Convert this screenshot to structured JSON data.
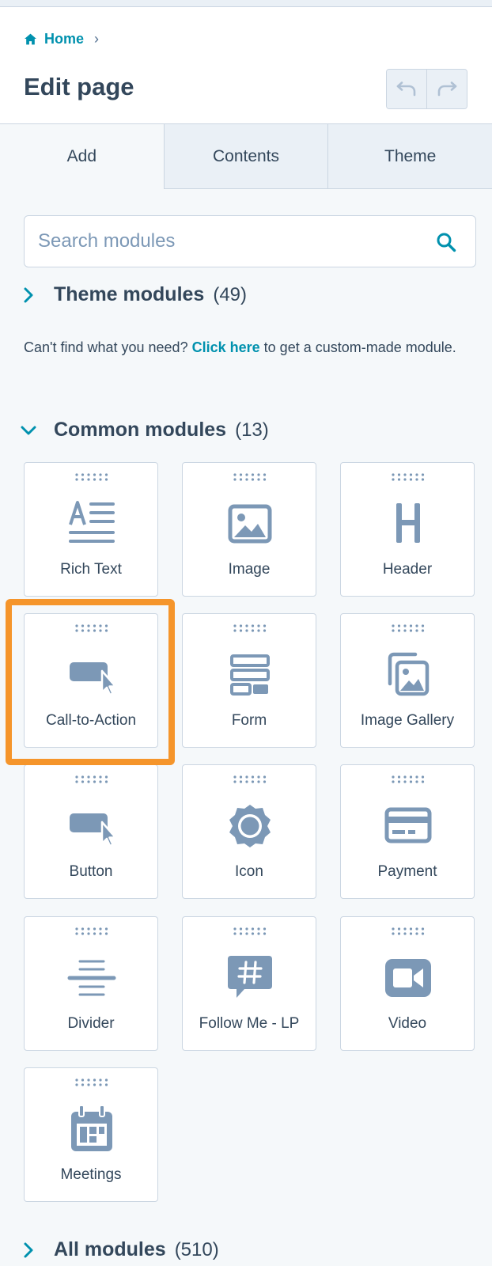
{
  "breadcrumb": {
    "home_label": "Home",
    "separator": "›"
  },
  "header": {
    "title": "Edit page"
  },
  "tabs": [
    {
      "label": "Add",
      "active": true
    },
    {
      "label": "Contents",
      "active": false
    },
    {
      "label": "Theme",
      "active": false
    }
  ],
  "search": {
    "placeholder": "Search modules",
    "value": ""
  },
  "sections": {
    "theme_modules": {
      "title": "Theme modules",
      "count": "(49)",
      "expanded": false
    },
    "common_modules": {
      "title": "Common modules",
      "count": "(13)",
      "expanded": true
    },
    "all_modules": {
      "title": "All modules",
      "count": "(510)",
      "expanded": false
    }
  },
  "help": {
    "text_before": "Can't find what you need?",
    "link_text": "Click here",
    "text_after": "to get a custom-made module."
  },
  "modules": [
    {
      "label": "Rich Text",
      "icon": "rich-text-icon"
    },
    {
      "label": "Image",
      "icon": "image-icon"
    },
    {
      "label": "Header",
      "icon": "header-icon"
    },
    {
      "label": "Call-to-Action",
      "icon": "call-to-action-icon",
      "highlighted": true
    },
    {
      "label": "Form",
      "icon": "form-icon"
    },
    {
      "label": "Image Gallery",
      "icon": "image-gallery-icon"
    },
    {
      "label": "Button",
      "icon": "button-icon"
    },
    {
      "label": "Icon",
      "icon": "icon-module-icon"
    },
    {
      "label": "Payment",
      "icon": "payment-icon"
    },
    {
      "label": "Divider",
      "icon": "divider-icon"
    },
    {
      "label": "Follow Me - LP",
      "icon": "follow-me-icon"
    },
    {
      "label": "Video",
      "icon": "video-icon"
    },
    {
      "label": "Meetings",
      "icon": "meetings-icon"
    }
  ],
  "colors": {
    "link": "#0091ae",
    "text": "#33475b",
    "icon": "#7c98b6",
    "border": "#cbd6e2",
    "highlight": "#f5952b",
    "background": "#f5f8fa"
  }
}
